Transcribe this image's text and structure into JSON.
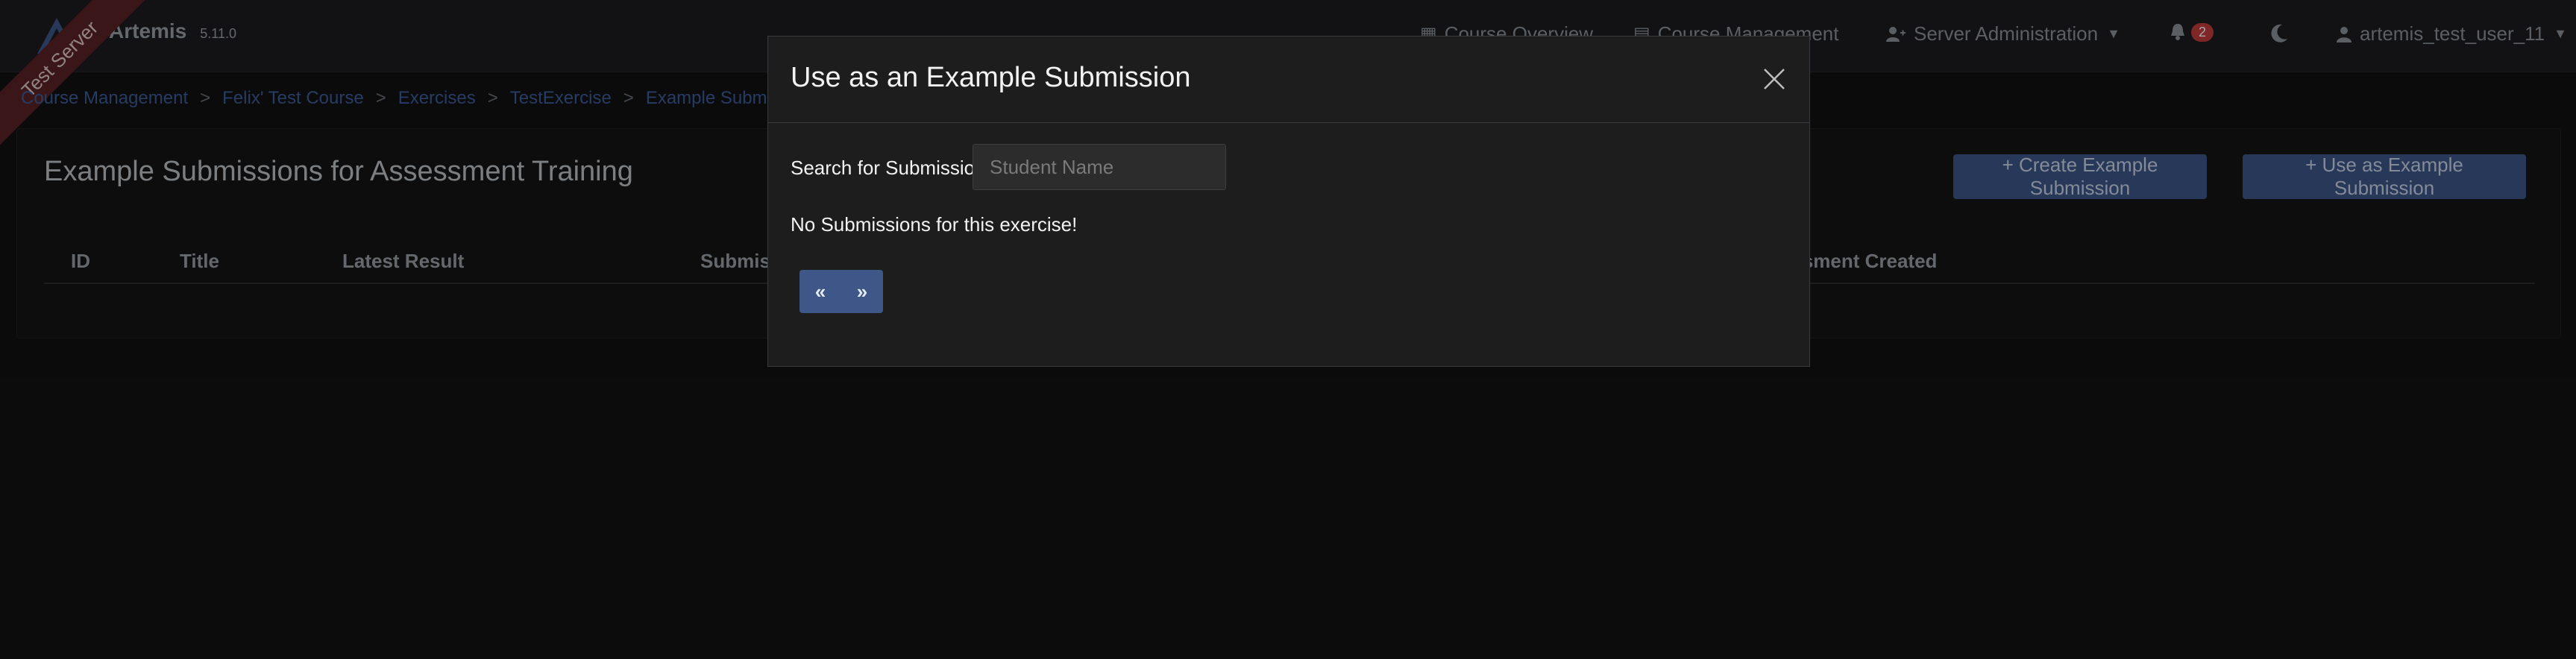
{
  "topbar": {
    "brand_name": "Artemis",
    "version": "5.11.0",
    "ribbon": "Test Server",
    "nav": {
      "course_overview": "Course Overview",
      "course_management": "Course Management",
      "server_administration": "Server Administration",
      "notification_count": "2",
      "user": "artemis_test_user_11"
    }
  },
  "breadcrumb": [
    "Course Management",
    "Felix' Test Course",
    "Exercises",
    "TestExercise",
    "Example Submissions"
  ],
  "breadcrumb_separator": ">",
  "page": {
    "title": "Example Submissions for Assessment Training",
    "create_button": "+ Create Example Submission",
    "use_button": "+ Use as Example Submission",
    "columns": {
      "id": "ID",
      "title": "Title",
      "latest_result": "Latest Result",
      "submission": "Submission",
      "assessment_created": "Example Assessment Created"
    }
  },
  "modal": {
    "title": "Use as an Example Submission",
    "search_label": "Search for Submission",
    "search_placeholder": "Student Name",
    "empty_message": "No Submissions for this exercise!",
    "pager_prev": "«",
    "pager_next": "»"
  },
  "colors": {
    "accent": "#3e5688",
    "badge": "#c43b3b",
    "ribbon": "#5a2327"
  }
}
